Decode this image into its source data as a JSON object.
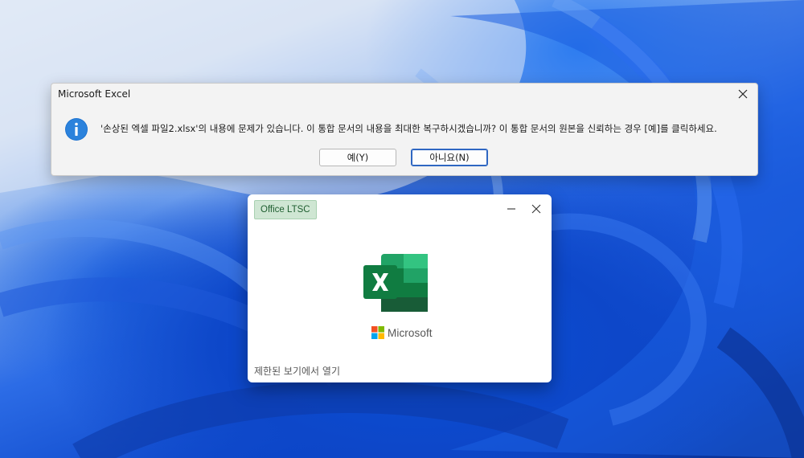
{
  "dialog": {
    "title": "Microsoft Excel",
    "message": "'손상된 엑셀 파일2.xlsx'의 내용에 문제가 있습니다. 이 통합 문서의 내용을 최대한 복구하시겠습니까? 이 통합 문서의 원본을 신뢰하는 경우 [예]를 클릭하세요.",
    "yes_label": "예(Y)",
    "no_label": "아니요(N)",
    "icon": "info-icon"
  },
  "splash": {
    "badge": "Office LTSC",
    "brand": "Microsoft",
    "status": "제한된 보기에서 열기",
    "app_icon": "excel-icon"
  },
  "colors": {
    "accent": "#2f67c2",
    "excel_green": "#185c37",
    "badge_bg": "#cfe6d3"
  }
}
